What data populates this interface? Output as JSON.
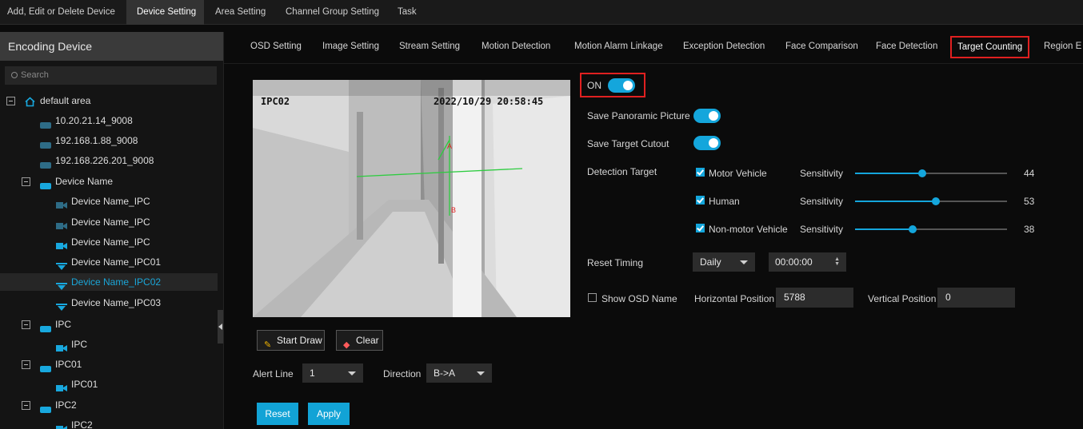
{
  "top_tabs": [
    {
      "label": "Add, Edit or Delete Device"
    },
    {
      "label": "Device Setting"
    },
    {
      "label": "Area Setting"
    },
    {
      "label": "Channel Group Setting"
    },
    {
      "label": "Task"
    }
  ],
  "sidebar": {
    "title": "Encoding Device",
    "search_placeholder": "Search",
    "tree": [
      {
        "label": "default area",
        "icon": "home-icon"
      },
      {
        "label": "10.20.21.14_9008",
        "icon": "server-icon"
      },
      {
        "label": "192.168.1.88_9008",
        "icon": "server-icon"
      },
      {
        "label": "192.168.226.201_9008",
        "icon": "server-icon"
      },
      {
        "label": "Device Name",
        "icon": "nvr-icon"
      },
      {
        "label": "Device Name_IPC",
        "icon": "camera-icon"
      },
      {
        "label": "Device Name_IPC",
        "icon": "camera-icon"
      },
      {
        "label": "Device Name_IPC",
        "icon": "camera-icon"
      },
      {
        "label": "Device Name_IPC01",
        "icon": "dome-camera-icon"
      },
      {
        "label": "Device Name_IPC02",
        "icon": "dome-camera-icon",
        "selected": true
      },
      {
        "label": "Device Name_IPC03",
        "icon": "dome-camera-icon"
      },
      {
        "label": "IPC",
        "icon": "nvr-icon"
      },
      {
        "label": "IPC",
        "icon": "camera-icon"
      },
      {
        "label": "IPC01",
        "icon": "nvr-icon"
      },
      {
        "label": "IPC01",
        "icon": "camera-icon"
      },
      {
        "label": "IPC2",
        "icon": "nvr-icon"
      },
      {
        "label": "IPC2",
        "icon": "camera-icon"
      }
    ]
  },
  "sub_tabs": [
    {
      "label": "OSD Setting"
    },
    {
      "label": "Image Setting"
    },
    {
      "label": "Stream Setting"
    },
    {
      "label": "Motion Detection"
    },
    {
      "label": "Motion Alarm Linkage"
    },
    {
      "label": "Exception Detection"
    },
    {
      "label": "Face Comparison"
    },
    {
      "label": "Face Detection"
    },
    {
      "label": "Target Counting",
      "active": true
    },
    {
      "label": "Region E"
    }
  ],
  "preview": {
    "osd_channel": "IPC02",
    "osd_time": "2022/10/29 20:58:45",
    "line_label_a": "A",
    "line_label_b": "B"
  },
  "draw_controls": {
    "start_draw": "Start Draw",
    "clear": "Clear",
    "alert_line_label": "Alert Line",
    "alert_line_value": "1",
    "direction_label": "Direction",
    "direction_value": "B->A"
  },
  "actions": {
    "reset": "Reset",
    "apply": "Apply"
  },
  "settings": {
    "on_label": "ON",
    "save_panoramic_label": "Save Panoramic Picture",
    "save_cutout_label": "Save Target Cutout",
    "detection_target_label": "Detection Target",
    "targets": [
      {
        "name": "Motor Vehicle",
        "sensitivity_label": "Sensitivity",
        "value": 44
      },
      {
        "name": "Human",
        "sensitivity_label": "Sensitivity",
        "value": 53
      },
      {
        "name": "Non-motor Vehicle",
        "sensitivity_label": "Sensitivity",
        "value": 38
      }
    ],
    "reset_timing_label": "Reset Timing",
    "reset_timing_value": "Daily",
    "reset_time_value": "00:00:00",
    "show_osd_label": "Show OSD Name",
    "horizontal_position_label": "Horizontal Position",
    "horizontal_position_value": "5788",
    "vertical_position_label": "Vertical Position",
    "vertical_position_value": "0"
  },
  "colors": {
    "accent": "#14a6dc",
    "highlight_box": "#e02020",
    "alert_line": "#2ecc40"
  }
}
